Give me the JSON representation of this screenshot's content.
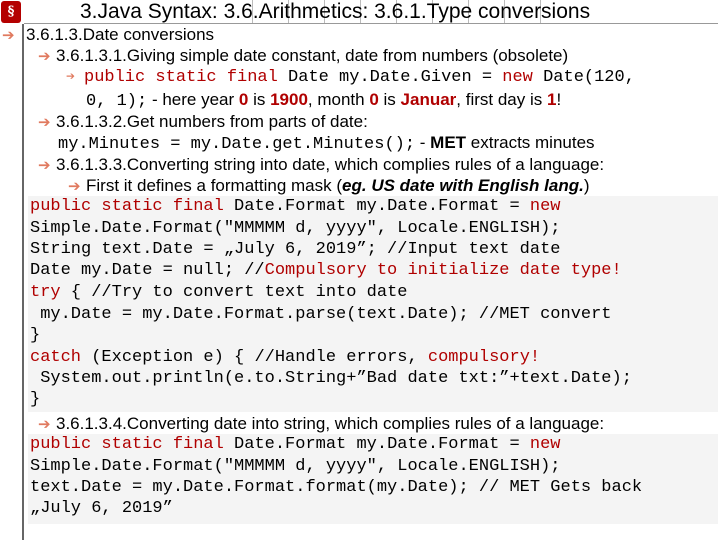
{
  "title": "3.Java Syntax: 3.6.Arithmetics: 3.6.1.Type conversions",
  "logo_glyph": "§",
  "arrow_glyph": "➔",
  "l1": "3.6.1.3.Date conversions",
  "l2": "3.6.1.3.1.Giving simple date constant, date from numbers (obsolete)",
  "l3": {
    "p1": "public static final",
    "p2": " Date my.Date.Given = ",
    "p3": "new",
    "p4": " Date(120,"
  },
  "l4": {
    "p1": "0, 1);",
    "p2": " - here year ",
    "p3": "0",
    "p4": " is ",
    "p5": "1900",
    "p6": ", month ",
    "p7": "0",
    "p8": " is ",
    "p9": "Januar",
    "p10": ", first day is ",
    "p11": "1",
    "p12": "!"
  },
  "l5": "3.6.1.3.2.Get numbers from parts of date:",
  "l6": {
    "p1": "my.Minutes = my.Date.get.Minutes();",
    "p2": " - ",
    "p3": "MET",
    "p4": " extracts minutes"
  },
  "l7": "3.6.1.3.3.Converting string into date, which complies rules of a language:",
  "l8": {
    "p1": "First it defines a formatting mask (",
    "p2": "eg. US date with English lang.",
    "p3": ")"
  },
  "c1": [
    {
      "a": "public static final",
      "b": " Date.Format my.Date.Format = ",
      "c": "new"
    },
    {
      "a": "Simple.Date.Format(\"MMMMM d, yyyy\", Locale.ENGLISH);"
    },
    {
      "a": "String text.Date = „July 6, 2019”; //Input text date"
    },
    {
      "a": "Date my.Date = null; //",
      "b": "Compulsory to initialize date type!"
    },
    {
      "a": "try",
      "b": " { //Try to convert text into date"
    },
    {
      "a": " my.Date = my.Date.Format.parse(text.Date); //MET convert"
    },
    {
      "a": "}"
    },
    {
      "a": "catch",
      "b": " (Exception e) { //Handle errors, ",
      "c": "compulsory!"
    },
    {
      "a": " System.out.println(e.to.String+”Bad date txt:”+text.Date);"
    },
    {
      "a": "}"
    }
  ],
  "l9": "3.6.1.3.4.Converting date into string, which complies rules of a language:",
  "c2": [
    {
      "a": "public static final",
      "b": " Date.Format my.Date.Format = ",
      "c": "new"
    },
    {
      "a": "Simple.Date.Format(\"MMMMM d, yyyy\", Locale.ENGLISH);"
    },
    {
      "a": "text.Date = my.Date.Format.format(my.Date); // MET Gets back"
    },
    {
      "a": "„July 6, 2019”"
    }
  ]
}
